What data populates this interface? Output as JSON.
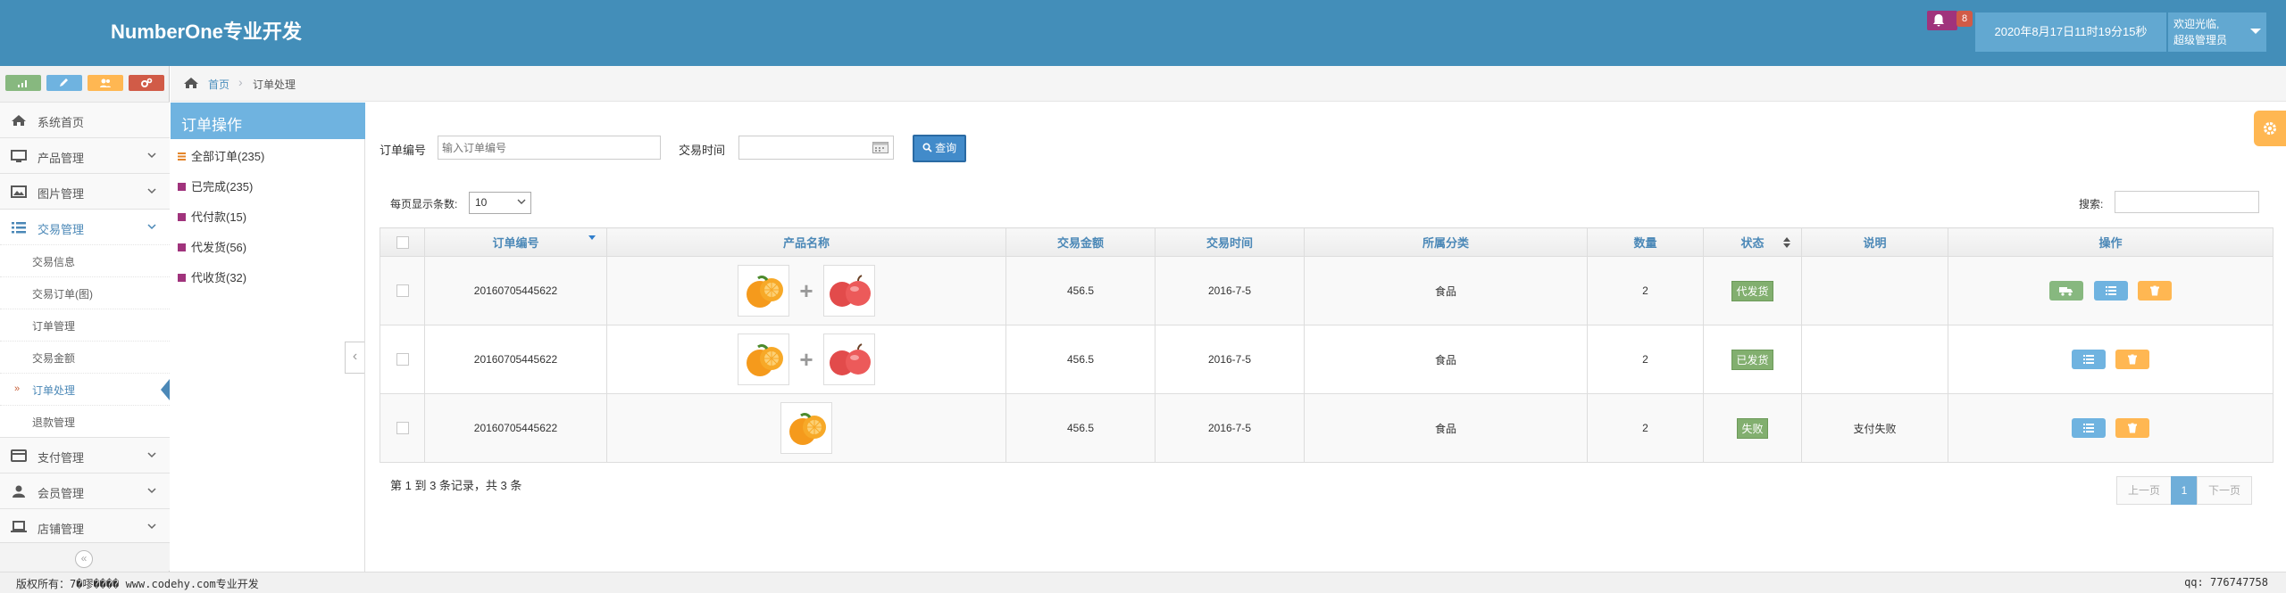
{
  "header": {
    "brand": "NumberOne专业开发",
    "notification_count": "8",
    "datetime": "2020年8月17日11时19分15秒",
    "welcome": "欢迎光临,",
    "role": "超级管理员"
  },
  "shortcuts": {
    "colors": [
      "#87b87f",
      "#6fb3e0",
      "#ffb752",
      "#d15b47"
    ]
  },
  "sidebar": {
    "items": [
      {
        "label": "系统首页",
        "icon": "home-icon"
      },
      {
        "label": "产品管理",
        "icon": "desktop-icon"
      },
      {
        "label": "图片管理",
        "icon": "picture-icon"
      },
      {
        "label": "交易管理",
        "icon": "list-icon"
      },
      {
        "label": "支付管理",
        "icon": "credit-card-icon"
      },
      {
        "label": "会员管理",
        "icon": "user-icon"
      },
      {
        "label": "店铺管理",
        "icon": "laptop-icon"
      }
    ],
    "subitems": [
      "交易信息",
      "交易订单(图)",
      "订单管理",
      "交易金额",
      "订单处理",
      "退款管理"
    ]
  },
  "breadcrumb": {
    "home": "首页",
    "current": "订单处理"
  },
  "order_ops": {
    "title": "订单操作",
    "items": [
      {
        "label": "全部订单(235)",
        "color": "#e4852a"
      },
      {
        "label": "已完成(235)",
        "color": "#a0337c"
      },
      {
        "label": "代付款(15)",
        "color": "#a0337c"
      },
      {
        "label": "代发货(56)",
        "color": "#a0337c"
      },
      {
        "label": "代收货(32)",
        "color": "#a0337c"
      }
    ]
  },
  "filters": {
    "order_no_label": "订单编号",
    "order_no_placeholder": "输入订单编号",
    "trade_time_label": "交易时间",
    "search_label": "查询",
    "page_size_label": "每页显示条数:",
    "page_size_value": "10",
    "search_box_label": "搜索:"
  },
  "table": {
    "headers": [
      "订单编号",
      "产品名称",
      "交易金额",
      "交易时间",
      "所属分类",
      "数量",
      "状态",
      "说明",
      "操作"
    ],
    "rows": [
      {
        "order_no": "20160705445622",
        "images": [
          "orange",
          "apple"
        ],
        "amount": "456.5",
        "time": "2016-7-5",
        "category": "食品",
        "qty": "2",
        "status": "代发货",
        "note": "",
        "actions": [
          "truck",
          "list",
          "trash"
        ]
      },
      {
        "order_no": "20160705445622",
        "images": [
          "orange",
          "apple"
        ],
        "amount": "456.5",
        "time": "2016-7-5",
        "category": "食品",
        "qty": "2",
        "status": "已发货",
        "note": "",
        "actions": [
          "list",
          "trash"
        ]
      },
      {
        "order_no": "20160705445622",
        "images": [
          "orange"
        ],
        "amount": "456.5",
        "time": "2016-7-5",
        "category": "食品",
        "qty": "2",
        "status": "失败",
        "note": "支付失败",
        "actions": [
          "list",
          "trash"
        ]
      }
    ]
  },
  "pagination": {
    "info": "第 1 到 3 条记录，共 3 条",
    "prev": "上一页",
    "current": "1",
    "next": "下一页"
  },
  "footer": {
    "left": "版权所有：7�嘐���� www.codehy.com专业开发",
    "right": "qq: 776747758"
  }
}
